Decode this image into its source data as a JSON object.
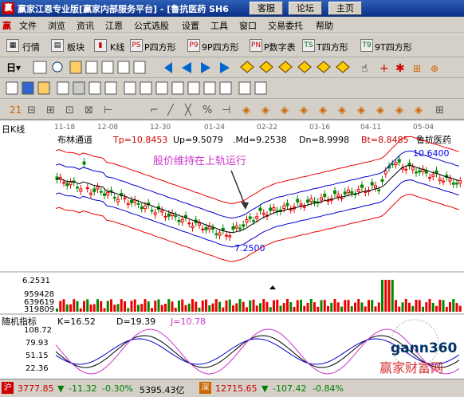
{
  "titlebar": {
    "title": "赢家江恩专业版[赢家内部服务平台] - [鲁抗医药  SH6",
    "buttons": [
      "客服",
      "论坛",
      "主页"
    ]
  },
  "menu": [
    "文件",
    "浏览",
    "资讯",
    "江恩",
    "公式选股",
    "设置",
    "工具",
    "窗口",
    "交易委托",
    "帮助"
  ],
  "toolbar1": {
    "items": [
      "行情",
      "板块",
      "K线",
      "P四方形",
      "9P四方形",
      "P数字表",
      "T四方形",
      "9T四方形"
    ],
    "icons": [
      "quote-icon",
      "block-icon",
      "kline-icon",
      "p-square-icon",
      "9p-square-icon",
      "p-number-icon",
      "t-square-icon",
      "9t-square-icon"
    ],
    "labels": [
      "PS",
      "P9",
      "PN",
      "TS",
      "T9"
    ]
  },
  "chart": {
    "period_label": "日K线",
    "dates": [
      "11-18",
      "12-08",
      "12-30",
      "01-24",
      "02-22",
      "03-16",
      "04-11",
      "05-04"
    ],
    "indicator": "布林通道",
    "tp": "Tp=10.8453",
    "up": "Up=9.5079",
    "md": ".Md=9.2538",
    "dn": "Dn=8.9998",
    "bt": "Bt=8.8485",
    "stock": "鲁抗医药",
    "annotation": "股价维持在上轨运行",
    "high_label": "10.6400",
    "low_label": "7.2500",
    "volume_labels": [
      "6.2531",
      "959428",
      "639619",
      "319809"
    ],
    "kdj_title": "随机指标",
    "k": "K=16.52",
    "d": "D=19.39",
    "j": "J=10.78",
    "kdj_axis": [
      "108.72",
      "79.93",
      "51.15",
      "22.36"
    ],
    "watermark_logo": "gann360",
    "watermark_text": "赢家财富网"
  },
  "status": {
    "sh_index": "3777.85",
    "sh_change": "-11.32",
    "sh_pct": "-0.30%",
    "sh_amount": "5395.43亿",
    "sz_index": "12715.65",
    "sz_change": "-107.42",
    "sz_pct": "-0.84%"
  },
  "colors": {
    "up": "#ff0000",
    "down": "#008000",
    "band": "#ff0000",
    "mid": "#0000ff"
  }
}
